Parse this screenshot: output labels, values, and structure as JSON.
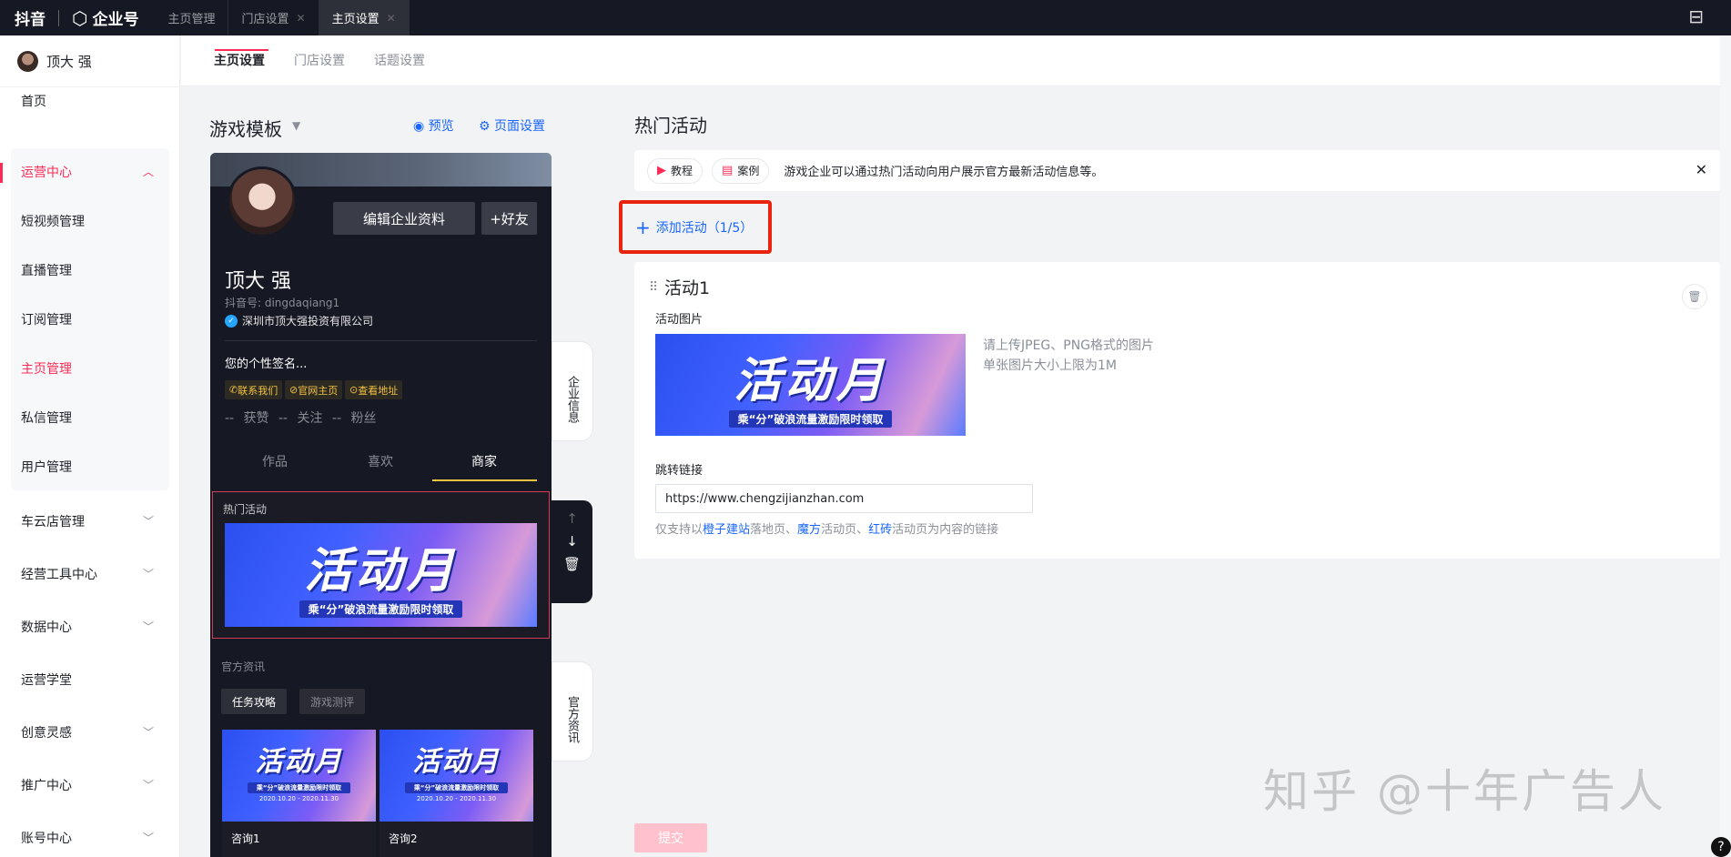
{
  "topbar": {
    "brand_name": "抖音",
    "product_name": "企业号",
    "tabs": [
      {
        "label": "主页管理",
        "close": ""
      },
      {
        "label": "门店设置",
        "close": "✕"
      },
      {
        "label": "主页设置",
        "close": "✕"
      }
    ]
  },
  "sidebar": {
    "user_name": "顶大 强",
    "items": [
      {
        "label": "首页"
      },
      {
        "label": "运营中心"
      },
      {
        "label": "短视频管理"
      },
      {
        "label": "直播管理"
      },
      {
        "label": "订阅管理"
      },
      {
        "label": "主页管理"
      },
      {
        "label": "私信管理"
      },
      {
        "label": "用户管理"
      },
      {
        "label": "车云店管理"
      },
      {
        "label": "经营工具中心"
      },
      {
        "label": "数据中心"
      },
      {
        "label": "运营学堂"
      },
      {
        "label": "创意灵感"
      },
      {
        "label": "推广中心"
      },
      {
        "label": "账号中心"
      }
    ]
  },
  "subtabs": [
    "主页设置",
    "门店设置",
    "话题设置"
  ],
  "template": {
    "title": "游戏模板",
    "preview": "预览",
    "page_settings": "页面设置"
  },
  "phone": {
    "edit_button": "编辑企业资料",
    "friend_button": "+好友",
    "name": "顶大 强",
    "douyin_id": "抖音号: dingdaqiang1",
    "company": "深圳市顶大强投资有限公司",
    "signature": "您的个性签名...",
    "chips": [
      "联系我们",
      "官网主页",
      "查看地址"
    ],
    "stats": "-- 获赞   -- 关注   -- 粉丝",
    "tabs": [
      "作品",
      "喜欢",
      "商家"
    ],
    "hot_label": "热门活动",
    "banner_big": "活动月",
    "banner_small": "乘“分”破浪流量激励限时领取",
    "news_label": "官方资讯",
    "news_chips": [
      "任务攻略",
      "游戏测评"
    ],
    "news_items": [
      {
        "caption": "咨询1",
        "date": "2020.10.20 - 2020.11.30"
      },
      {
        "caption": "咨询2",
        "date": "2020.10.20 - 2020.11.30"
      }
    ]
  },
  "side_tools": {
    "company_info": "企业信息",
    "official_news": "官方资讯"
  },
  "main": {
    "title": "热门活动",
    "tutorial": "教程",
    "case": "案例",
    "info_text": "游戏企业可以通过热门活动向用户展示官方最新活动信息等。",
    "add_activity": "添加活动（1/5）",
    "card": {
      "title": "活动1",
      "image_label": "活动图片",
      "hint_line1": "请上传JPEG、PNG格式的图片",
      "hint_line2": "单张图片大小上限为1M",
      "link_label": "跳转链接",
      "link_value": "https://www.chengzijianzhan.com",
      "note_prefix": "仅支持以",
      "note_link1": "橙子建站",
      "note_mid1": "落地页、",
      "note_link2": "魔方",
      "note_mid2": "活动页、",
      "note_link3": "红砖",
      "note_suffix": "活动页为内容的链接"
    },
    "submit": "提交"
  },
  "watermark": "知乎 @十年广告人",
  "colors": {
    "accent": "#fe2c55",
    "link": "#1966ff",
    "dark": "#161823"
  }
}
